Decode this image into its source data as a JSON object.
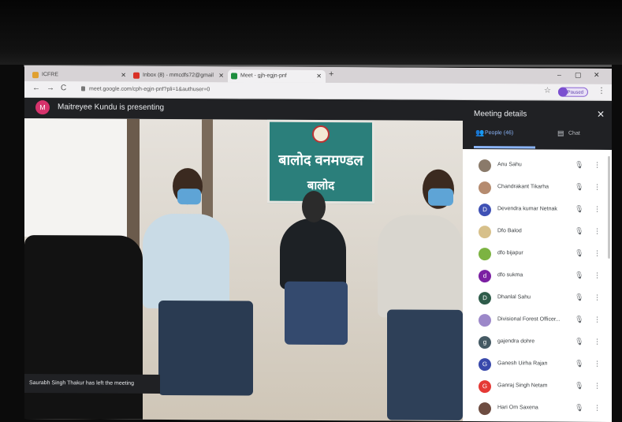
{
  "browser": {
    "tabs": [
      {
        "title": "ICFRE",
        "fav_color": "#e0a030"
      },
      {
        "title": "Inbox (8) - mmcdfs72@gmail",
        "fav_color": "#d93025"
      },
      {
        "title": "Meet - gjh-egjn-pnf",
        "fav_color": "#1e8e3e"
      }
    ],
    "new_tab": "+",
    "url": "meet.google.com/cph-egjn-pnf?pli=1&authuser=0",
    "paused_label": "Paused",
    "win_min": "–",
    "win_max": "▢",
    "win_close": "✕",
    "nav_back": "←",
    "nav_fwd": "→",
    "nav_reload": "C",
    "star": "☆",
    "kebab": "⋮"
  },
  "meet": {
    "presenter_initial": "M",
    "presenter_text": "Maitreyee Kundu is presenting",
    "banner_line1": "बालोद वनमण्डल",
    "banner_line2": "बालोद",
    "toast": "Saurabh Singh Thakur has left the meeting"
  },
  "panel": {
    "title": "Meeting details",
    "close": "✕",
    "people_tab": "People (46)",
    "chat_tab": "Chat",
    "people": [
      {
        "initial": "",
        "name": "Anu Sahu",
        "color": "#8a7a6a"
      },
      {
        "initial": "",
        "name": "Chandrakant Tikarha",
        "color": "#b58b6f"
      },
      {
        "initial": "D",
        "name": "Devendra kumar Netnak",
        "color": "#3f51b5"
      },
      {
        "initial": "",
        "name": "Dfo Balod",
        "color": "#d7c08a"
      },
      {
        "initial": "",
        "name": "dfo bijapur",
        "color": "#7cb342"
      },
      {
        "initial": "d",
        "name": "dfo sukma",
        "color": "#7b1fa2"
      },
      {
        "initial": "D",
        "name": "Dhanlal Sahu",
        "color": "#2e5c4a"
      },
      {
        "initial": "",
        "name": "Divisional Forest Officer...",
        "color": "#9c88c9"
      },
      {
        "initial": "g",
        "name": "gajendra dohre",
        "color": "#455a64"
      },
      {
        "initial": "G",
        "name": "Ganesh Uirha Rajan",
        "color": "#3949ab"
      },
      {
        "initial": "G",
        "name": "Ganraj Singh Netam",
        "color": "#e53935"
      },
      {
        "initial": "",
        "name": "Hari Om Saxena",
        "color": "#6d4c41"
      }
    ],
    "mic_icon": "🎙",
    "more_icon": "⋮"
  }
}
